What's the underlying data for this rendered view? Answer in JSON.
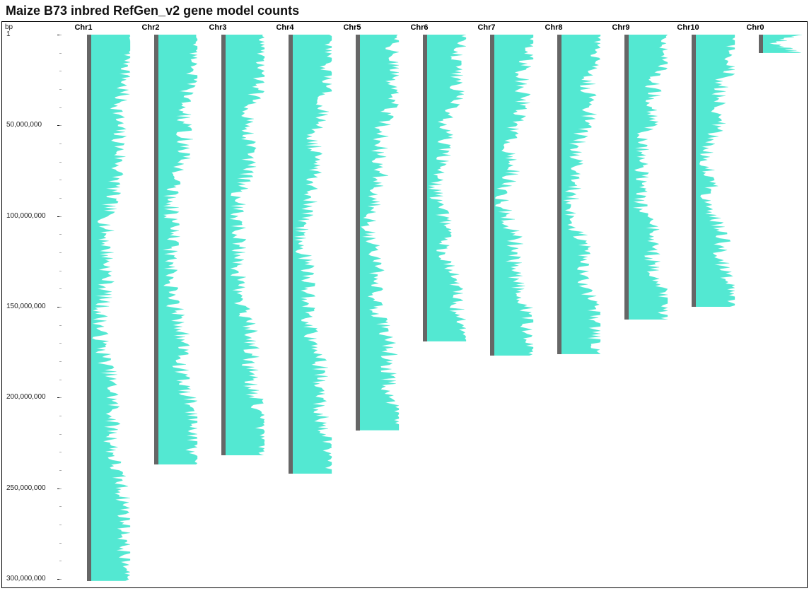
{
  "title": "Maize B73 inbred RefGen_v2 gene model counts",
  "y_axis_label": "bp",
  "chart_data": {
    "type": "bar",
    "title": "Maize B73 inbred RefGen_v2 gene model counts",
    "y_axis": {
      "label": "bp",
      "ticks": [
        1,
        50000000,
        100000000,
        150000000,
        200000000,
        250000000,
        300000000
      ],
      "tick_labels": [
        "1",
        "50,000,000",
        "100,000,000",
        "150,000,000",
        "200,000,000",
        "250,000,000",
        "300,000,000"
      ],
      "minor_interval": 10000000,
      "orientation": "top-to-bottom"
    },
    "x_axis": {
      "categories": [
        "Chr1",
        "Chr2",
        "Chr3",
        "Chr4",
        "Chr5",
        "Chr6",
        "Chr7",
        "Chr8",
        "Chr9",
        "Chr10",
        "Chr0"
      ]
    },
    "chromosomes": [
      {
        "name": "Chr1",
        "length_bp": 301000000
      },
      {
        "name": "Chr2",
        "length_bp": 237000000
      },
      {
        "name": "Chr3",
        "length_bp": 232000000
      },
      {
        "name": "Chr4",
        "length_bp": 242000000
      },
      {
        "name": "Chr5",
        "length_bp": 218000000
      },
      {
        "name": "Chr6",
        "length_bp": 169000000
      },
      {
        "name": "Chr7",
        "length_bp": 177000000
      },
      {
        "name": "Chr8",
        "length_bp": 176000000
      },
      {
        "name": "Chr9",
        "length_bp": 157000000
      },
      {
        "name": "Chr10",
        "length_bp": 150000000
      },
      {
        "name": "Chr0",
        "length_bp": 10000000
      }
    ],
    "series_description": "Horizontal gene-model density (count) per genomic bin, plotted as a teal bar extending rightward from each chromosome backbone. Density is high near chromosome ends (telomeres) and low near centromeres."
  },
  "y_ticks": [
    {
      "label": "1",
      "bp": 1
    },
    {
      "label": "50,000,000",
      "bp": 50000000
    },
    {
      "label": "100,000,000",
      "bp": 100000000
    },
    {
      "label": "150,000,000",
      "bp": 150000000
    },
    {
      "label": "200,000,000",
      "bp": 200000000
    },
    {
      "label": "250,000,000",
      "bp": 250000000
    },
    {
      "label": "300,000,000",
      "bp": 300000000
    }
  ],
  "columns": [
    "Chr1",
    "Chr2",
    "Chr3",
    "Chr4",
    "Chr5",
    "Chr6",
    "Chr7",
    "Chr8",
    "Chr9",
    "Chr10",
    "Chr0"
  ]
}
